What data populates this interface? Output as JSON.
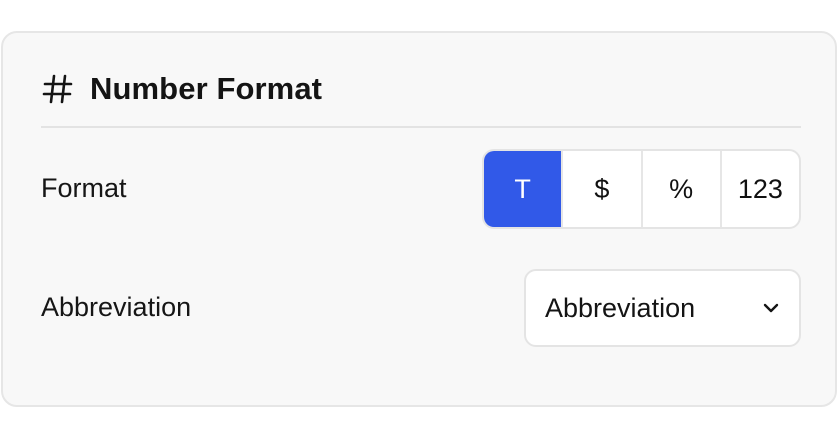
{
  "panel": {
    "title": "Number Format",
    "icon": "hash-icon"
  },
  "format": {
    "label": "Format",
    "options": [
      "T",
      "$",
      "%",
      "123"
    ],
    "selected": "T",
    "accent_color": "#3159e8"
  },
  "abbreviation": {
    "label": "Abbreviation",
    "value": "Abbreviation",
    "icon": "chevron-down-icon"
  }
}
